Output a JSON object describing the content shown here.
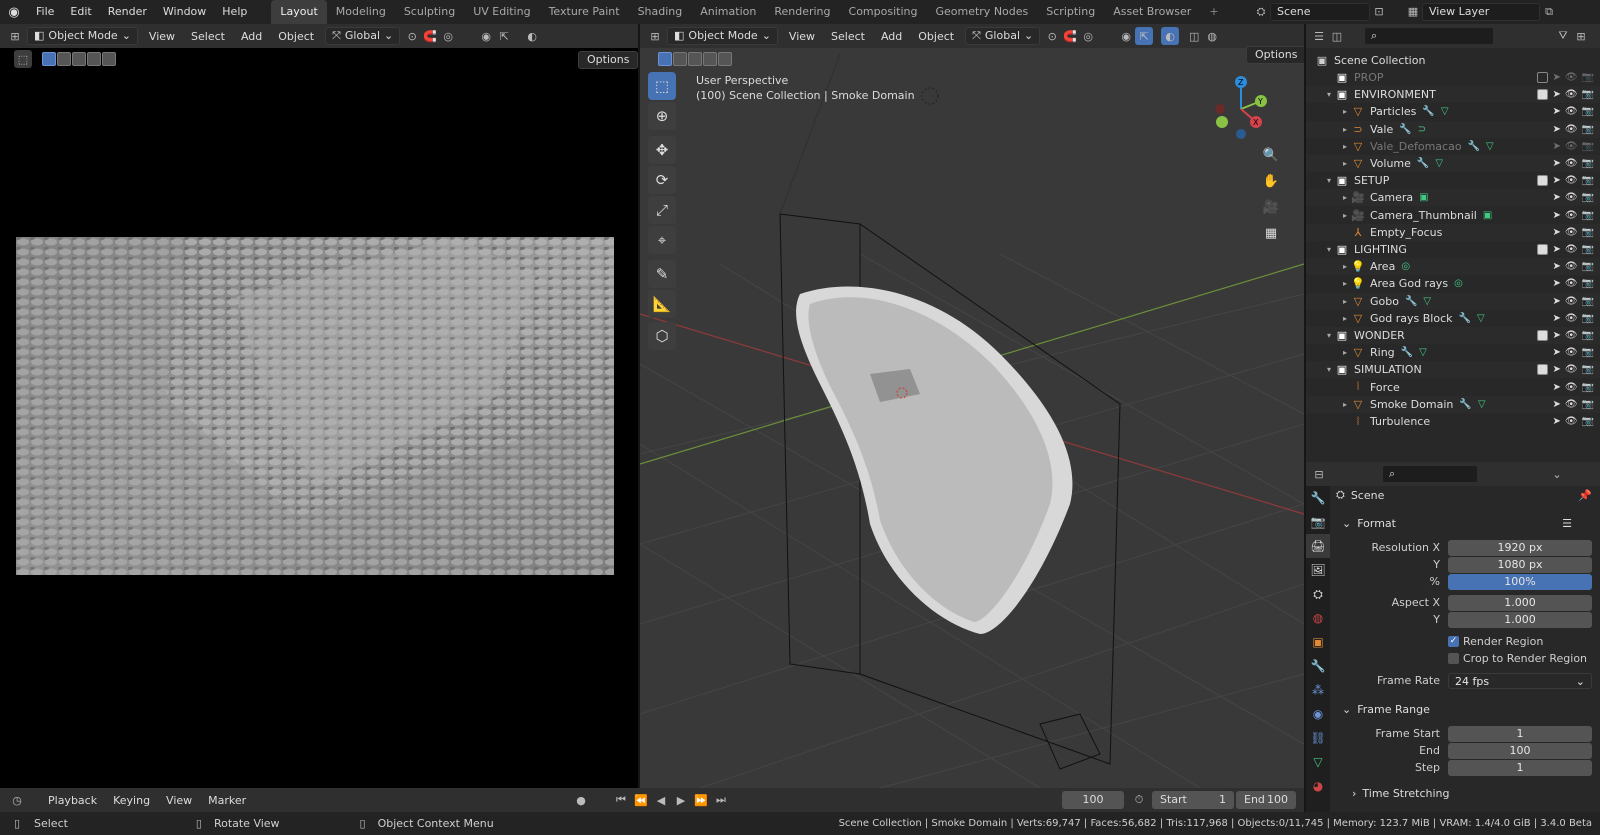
{
  "topbar": {
    "menus": [
      "File",
      "Edit",
      "Render",
      "Window",
      "Help"
    ],
    "workspaces": [
      "Layout",
      "Modeling",
      "Sculpting",
      "UV Editing",
      "Texture Paint",
      "Shading",
      "Animation",
      "Rendering",
      "Compositing",
      "Geometry Nodes",
      "Scripting",
      "Asset Browser"
    ],
    "active_workspace": "Layout",
    "scene": "Scene",
    "view_layer": "View Layer"
  },
  "left_editor": {
    "mode": "Object Mode",
    "menus": [
      "View",
      "Select",
      "Add",
      "Object"
    ],
    "orientation": "Global",
    "options": "Options"
  },
  "viewport": {
    "mode": "Object Mode",
    "menus": [
      "View",
      "Select",
      "Add",
      "Object"
    ],
    "orientation": "Global",
    "options": "Options",
    "info_line1": "User Perspective",
    "info_line2": "(100) Scene Collection | Smoke Domain"
  },
  "outliner": {
    "root": "Scene Collection",
    "rows": [
      {
        "name": "PROP",
        "type": "collection",
        "level": 0,
        "dim": true
      },
      {
        "name": "ENVIRONMENT",
        "type": "collection",
        "level": 0
      },
      {
        "name": "Particles",
        "type": "mesh",
        "level": 1
      },
      {
        "name": "Vale",
        "type": "curve",
        "level": 1
      },
      {
        "name": "Vale_Defomacao",
        "type": "mesh",
        "level": 1,
        "dim": true
      },
      {
        "name": "Volume",
        "type": "mesh",
        "level": 1
      },
      {
        "name": "SETUP",
        "type": "collection",
        "level": 0
      },
      {
        "name": "Camera",
        "type": "camera",
        "level": 1
      },
      {
        "name": "Camera_Thumbnail",
        "type": "camera",
        "level": 1
      },
      {
        "name": "Empty_Focus",
        "type": "empty",
        "level": 1
      },
      {
        "name": "LIGHTING",
        "type": "collection",
        "level": 0
      },
      {
        "name": "Area",
        "type": "light",
        "level": 1
      },
      {
        "name": "Area God rays",
        "type": "light",
        "level": 1
      },
      {
        "name": "Gobo",
        "type": "mesh",
        "level": 1
      },
      {
        "name": "God rays Block",
        "type": "mesh",
        "level": 1
      },
      {
        "name": "WONDER",
        "type": "collection",
        "level": 0
      },
      {
        "name": "Ring",
        "type": "mesh",
        "level": 1
      },
      {
        "name": "SIMULATION",
        "type": "collection",
        "level": 0
      },
      {
        "name": "Force",
        "type": "force",
        "level": 1
      },
      {
        "name": "Smoke Domain",
        "type": "mesh",
        "level": 1
      },
      {
        "name": "Turbulence",
        "type": "force",
        "level": 1
      }
    ]
  },
  "properties": {
    "context": "Scene",
    "format_label": "Format",
    "res_x_label": "Resolution X",
    "res_x": "1920 px",
    "res_y_label": "Y",
    "res_y": "1080 px",
    "pct_label": "%",
    "pct": "100%",
    "aspect_x_label": "Aspect X",
    "aspect_x": "1.000",
    "aspect_y_label": "Y",
    "aspect_y": "1.000",
    "render_region": "Render Region",
    "crop_region": "Crop to Render Region",
    "frame_rate_label": "Frame Rate",
    "frame_rate": "24 fps",
    "frame_range_label": "Frame Range",
    "frame_start_label": "Frame Start",
    "frame_start": "1",
    "end_label": "End",
    "end": "100",
    "step_label": "Step",
    "step": "1",
    "time_stretching": "Time Stretching"
  },
  "timeline": {
    "menus": [
      "Playback",
      "Keying",
      "View",
      "Marker"
    ],
    "current_frame": "100",
    "start_label": "Start",
    "start": "1",
    "end_label": "End",
    "end": "100"
  },
  "status": {
    "select": "Select",
    "rotate": "Rotate View",
    "context_menu": "Object Context Menu",
    "stats": "Scene Collection | Smoke Domain | Verts:69,747 | Faces:56,682 | Tris:117,968 | Objects:0/11,745 | Memory: 123.7 MiB | VRAM: 1.4/4.0 GiB | 3.4.0 Beta"
  },
  "colors": {
    "accent": "#4772b3",
    "mesh": "#e08a34",
    "collection": "#ffffff",
    "tri": "#42c982",
    "axis_x": "#d4424b",
    "axis_y": "#8ac246",
    "axis_z": "#2a8de0"
  }
}
